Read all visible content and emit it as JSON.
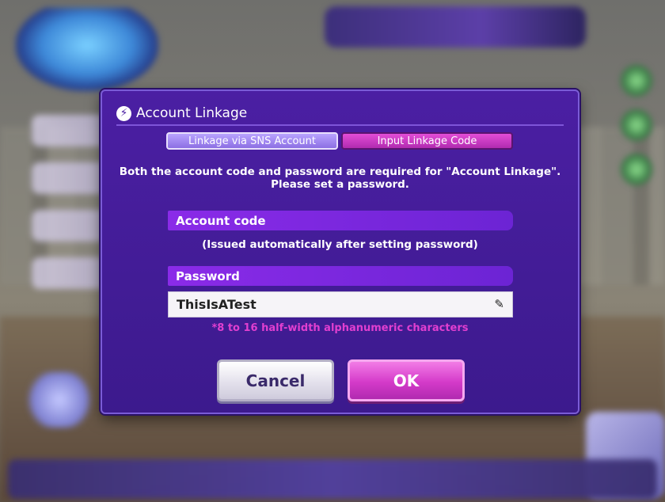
{
  "dialog": {
    "title": "Account Linkage",
    "title_icon": "lightning-bolt-icon",
    "tabs": [
      {
        "label": "Linkage via SNS Account",
        "selected": false
      },
      {
        "label": "Input Linkage Code",
        "selected": true
      }
    ],
    "info_line1": "Both the account code and password are required for \"Account Linkage\".",
    "info_line2": "Please set a password.",
    "account_code": {
      "label": "Account code",
      "note": "(Issued automatically after setting password)"
    },
    "password": {
      "label": "Password",
      "value": "ThisIsATest",
      "edit_icon": "pencil-icon",
      "hint": "*8 to 16 half-width alphanumeric characters"
    },
    "buttons": {
      "cancel": "Cancel",
      "ok": "OK"
    }
  },
  "colors": {
    "dialog_bg": "#4b1fa3",
    "section_bar": "#8a2be8",
    "accent_pink": "#d43ac9",
    "hint_pink": "#e13fd0",
    "tab_lavender": "#a68bf2"
  }
}
